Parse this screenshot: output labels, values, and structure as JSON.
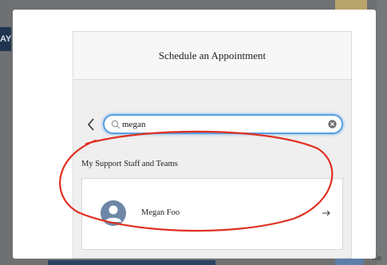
{
  "background": {
    "left_strip_text": "AY",
    "right_bottom_text": "Co"
  },
  "modal": {
    "title": "Schedule an Appointment",
    "search": {
      "value": "megan",
      "placeholder": ""
    },
    "section_label": "My Support Staff and Teams",
    "staff": [
      {
        "name": "Megan Foo",
        "arrow": "→"
      }
    ]
  },
  "icons": {
    "back": "chevron-left-icon",
    "search": "search-icon",
    "clear": "clear-icon",
    "avatar": "person-icon",
    "arrow": "arrow-right-icon"
  },
  "colors": {
    "search_border": "#5b9fde",
    "avatar_bg": "#6e87a6",
    "annotation": "#e03020",
    "background_nav": "#1f3550"
  }
}
